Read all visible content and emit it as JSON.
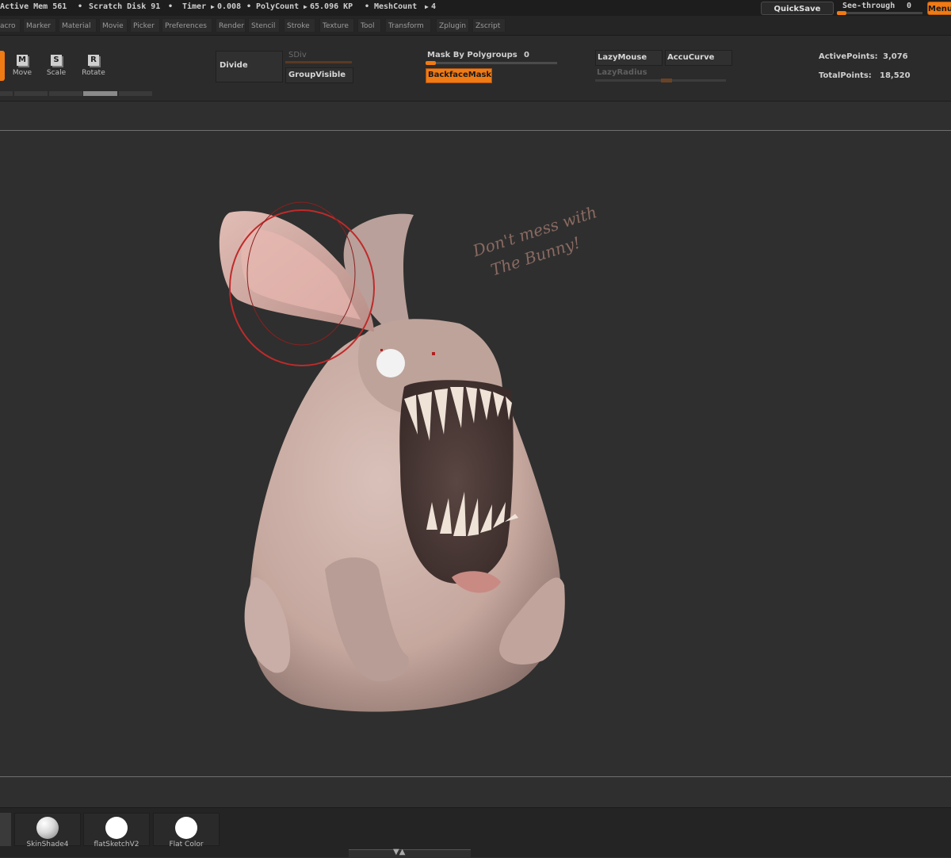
{
  "status": {
    "active_mem": "Active Mem 561",
    "scratch_disk": "Scratch Disk 91",
    "timer_label": "Timer",
    "timer_value": "0.008",
    "polycount_label": "PolyCount",
    "polycount_value": "65.096 KP",
    "meshcount_label": "MeshCount",
    "meshcount_value": "4",
    "quicksave": "QuickSave",
    "see_through_label": "See-through",
    "see_through_value": "0",
    "menus": "Menus"
  },
  "menus": [
    "acro",
    "Marker",
    "Material",
    "Movie",
    "Picker",
    "Preferences",
    "Render",
    "Stencil",
    "Stroke",
    "Texture",
    "Tool",
    "Transform",
    "Zplugin",
    "Zscript"
  ],
  "tools": {
    "move_letter": "M",
    "move": "Move",
    "scale_letter": "S",
    "scale": "Scale",
    "rotate_letter": "R",
    "rotate": "Rotate"
  },
  "subtools": {
    "divide": "Divide",
    "sdiv": "SDiv",
    "group_visible": "GroupVisible",
    "mask_by_polygroups_label": "Mask By Polygroups",
    "mask_by_polygroups_value": "0",
    "mask_by_polygroups_level": 0.08,
    "backface_mask": "BackfaceMask",
    "lazy_mouse": "LazyMouse",
    "accu_curve": "AccuCurve",
    "lazy_radius": "LazyRadius",
    "lazy_radius_level": 0.55
  },
  "stats": {
    "active_points_label": "ActivePoints:",
    "active_points": "3,076",
    "total_points_label": "TotalPoints:",
    "total_points": "18,520"
  },
  "canvas": {
    "note_line1": "Don't mess with",
    "note_line2": "The Bunny!"
  },
  "materials": [
    {
      "label": "SkinShade4",
      "color": "#e8e8e8"
    },
    {
      "label": "flatSketchV2",
      "color": "#ffffff"
    },
    {
      "label": "Flat Color",
      "color": "#ffffff"
    }
  ],
  "colors": {
    "accent": "#f07a14",
    "brush_ring": "#c02a2a",
    "bunny_skin": "#c8aca4"
  }
}
